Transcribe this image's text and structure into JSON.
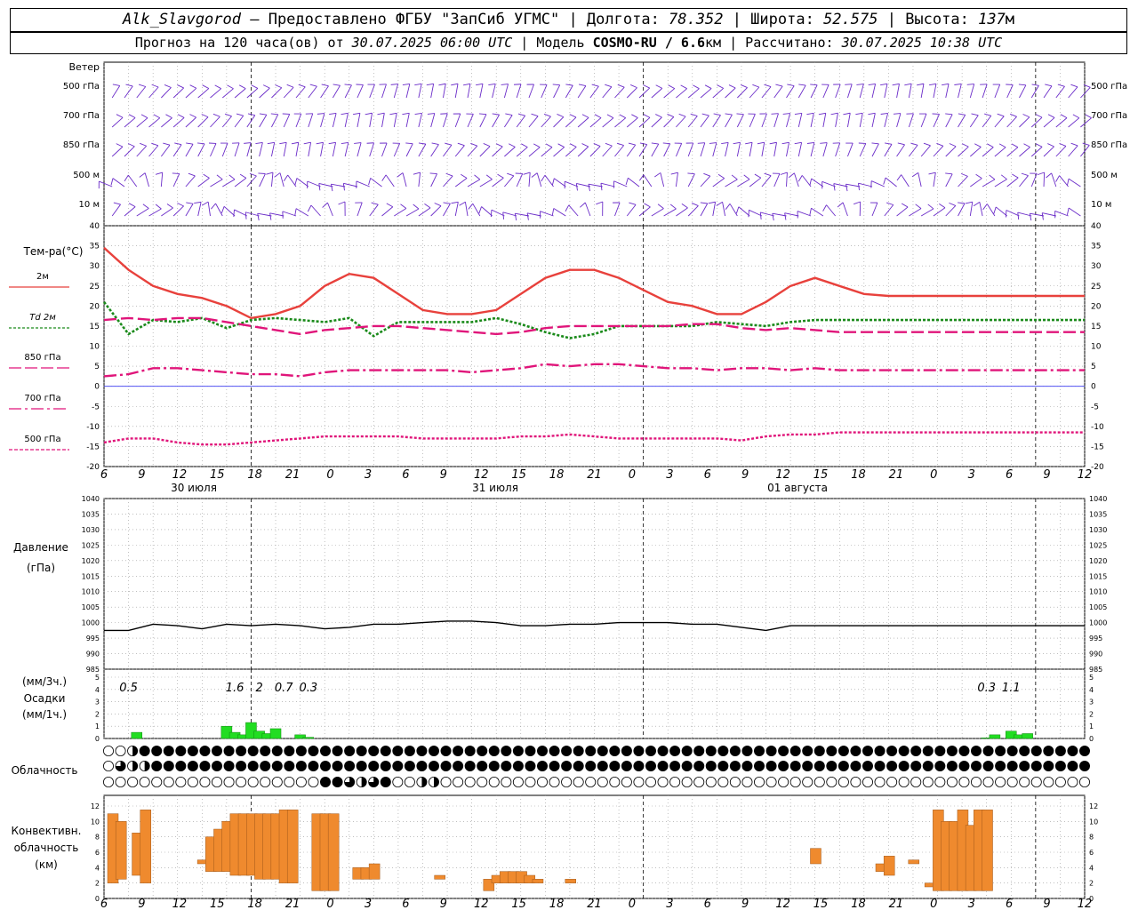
{
  "header": {
    "station": "Alk_Slavgorod",
    "provider": " — Предоставлено ФГБУ \"ЗапСиб УГМС\" | Долгота: ",
    "lon": "78.352",
    "lat_label": " | Широта: ",
    "lat": "52.575",
    "alt_label": " | Высота: ",
    "alt": "137",
    "alt_unit": "м",
    "forecast_label": "Прогноз на 120 часа(ов) от ",
    "forecast_from": "30.07.2025 06:00 UTC",
    "model_label": " | Модель ",
    "model": "COSMO-RU / 6.6",
    "model_unit": "км",
    "calc_label": " | Рассчитано: ",
    "calc_time": "30.07.2025 10:38 UTC"
  },
  "labels": {
    "wind_title": "Ветер",
    "wind_levels": [
      "500 гПа",
      "700 гПа",
      "850 гПа",
      "500 м",
      "10  м"
    ],
    "temp_title": "Тем-ра(°С)",
    "temp_legend": [
      {
        "label": "2м",
        "color": "#e8413c"
      },
      {
        "label": "Td  2м",
        "color": "#1a8a1a"
      },
      {
        "label": "850 гПа",
        "color": "#e0157a"
      },
      {
        "label": "700 гПа",
        "color": "#e0157a"
      },
      {
        "label": "500 гПа",
        "color": "#e0157a"
      }
    ],
    "pressure_title": "Давление",
    "pressure_unit": "(гПа)",
    "precip_unit_3h": "(мм/3ч.)",
    "precip_title": "Осадки",
    "precip_unit_1h": "(мм/1ч.)",
    "cloud_title": "Облачность",
    "conv_title_1": "Конвективн.",
    "conv_title_2": "облачность",
    "conv_unit": "(км)"
  },
  "axes": {
    "hour_ticks": [
      "6",
      "9",
      "12",
      "15",
      "18",
      "21",
      "0",
      "3",
      "6",
      "9",
      "12",
      "15",
      "18",
      "21",
      "0",
      "3",
      "6",
      "9",
      "12",
      "15",
      "18",
      "21",
      "0",
      "3",
      "6",
      "9",
      "12"
    ],
    "day_labels": [
      "30 июля",
      "31 июля",
      "01 августа"
    ],
    "temp_ticks": [
      40,
      35,
      30,
      25,
      20,
      15,
      10,
      5,
      0,
      -5,
      -10,
      -15,
      -20
    ],
    "pressure_ticks": [
      1040,
      1035,
      1030,
      1025,
      1020,
      1015,
      1010,
      1005,
      1000,
      995,
      990,
      985
    ],
    "precip_ticks": [
      5,
      4,
      3,
      2,
      1,
      0
    ],
    "conv_ticks": [
      12,
      10,
      8,
      6,
      4,
      2,
      0
    ]
  },
  "chart_data": {
    "type": "line",
    "x_hours": [
      0,
      3,
      6,
      9,
      12,
      15,
      18,
      21,
      24,
      27,
      30,
      33,
      36,
      39,
      42,
      45,
      48,
      51,
      54,
      57,
      60,
      63,
      66,
      69,
      72,
      75,
      78,
      81,
      84,
      87,
      90,
      93,
      96,
      99,
      102,
      105,
      108,
      111,
      114,
      117,
      120
    ],
    "series": [
      {
        "name": "2м",
        "color": "#e8413c",
        "values": [
          34.5,
          29,
          25,
          23,
          22,
          20,
          17,
          18,
          20,
          25,
          28,
          27,
          23,
          19,
          18,
          18,
          19,
          23,
          27,
          29,
          29,
          27,
          24,
          21,
          20,
          18,
          18,
          21,
          25,
          27,
          25,
          23,
          22.5,
          22.5,
          22.5,
          22.5,
          22.5,
          22.5,
          22.5,
          22.5,
          22.5
        ]
      },
      {
        "name": "Td  2м",
        "color": "#1a8a1a",
        "values": [
          21,
          13,
          16.5,
          16,
          17,
          14.5,
          16.5,
          17,
          16.5,
          16,
          17,
          12.5,
          16,
          16,
          16,
          16,
          17,
          15.5,
          13.5,
          12,
          13,
          15,
          15,
          15,
          15,
          16,
          15.5,
          15,
          16,
          16.5,
          16.5,
          16.5,
          16.5,
          16.5,
          16.5,
          16.5,
          16.5,
          16.5,
          16.5,
          16.5,
          16.5
        ]
      },
      {
        "name": "850 гПа",
        "color": "#e0157a",
        "values": [
          16.5,
          17,
          16.5,
          17,
          17,
          16,
          15,
          14,
          13,
          14,
          14.5,
          15,
          15,
          14.5,
          14,
          13.5,
          13,
          13.5,
          14.5,
          15,
          15,
          15,
          15,
          15,
          15.5,
          15.5,
          14.5,
          14,
          14.5,
          14,
          13.5,
          13.5,
          13.5,
          13.5,
          13.5,
          13.5,
          13.5,
          13.5,
          13.5,
          13.5,
          13.5
        ]
      },
      {
        "name": "700 гПа",
        "color": "#e0157a",
        "values": [
          2.5,
          3,
          4.5,
          4.5,
          4,
          3.5,
          3,
          3,
          2.5,
          3.5,
          4,
          4,
          4,
          4,
          4,
          3.5,
          4,
          4.5,
          5.5,
          5,
          5.5,
          5.5,
          5,
          4.5,
          4.5,
          4,
          4.5,
          4.5,
          4,
          4.5,
          4,
          4,
          4,
          4,
          4,
          4,
          4,
          4,
          4,
          4,
          4
        ]
      },
      {
        "name": "500 гПа",
        "color": "#e0157a",
        "values": [
          -14,
          -13,
          -13,
          -14,
          -14.5,
          -14.5,
          -14,
          -13.5,
          -13,
          -12.5,
          -12.5,
          -12.5,
          -12.5,
          -13,
          -13,
          -13,
          -13,
          -12.5,
          -12.5,
          -12,
          -12.5,
          -13,
          -13,
          -13,
          -13,
          -13,
          -13.5,
          -12.5,
          -12,
          -12,
          -11.5,
          -11.5,
          -11.5,
          -11.5,
          -11.5,
          -11.5,
          -11.5,
          -11.5,
          -11.5,
          -11.5,
          -11.5
        ]
      }
    ],
    "pressure": {
      "name": "Давление",
      "color": "#000000",
      "values": [
        997.5,
        997.5,
        999.5,
        999,
        998,
        999.5,
        999,
        999.5,
        999,
        998,
        998.5,
        999.5,
        999.5,
        1000,
        1000.5,
        1000.5,
        1000,
        999,
        999,
        999.5,
        999.5,
        1000,
        1000,
        1000,
        999.5,
        999.5,
        998.5,
        997.5,
        999,
        999,
        999,
        999,
        999,
        999,
        999,
        999,
        999,
        999,
        999,
        999,
        999
      ]
    },
    "precip_labels": [
      {
        "hour": 3,
        "text": "0.5"
      },
      {
        "hour": 16,
        "text": "1.6"
      },
      {
        "hour": 19,
        "text": "2"
      },
      {
        "hour": 22,
        "text": "0.7"
      },
      {
        "hour": 25,
        "text": "0.3"
      },
      {
        "hour": 108,
        "text": "0.3"
      },
      {
        "hour": 111,
        "text": "1.1"
      }
    ],
    "precip_bars_1h": [
      {
        "h": 4,
        "v": 0.5
      },
      {
        "h": 15,
        "v": 1.0
      },
      {
        "h": 16,
        "v": 0.5
      },
      {
        "h": 17,
        "v": 0.3
      },
      {
        "h": 18,
        "v": 1.3
      },
      {
        "h": 19,
        "v": 0.6
      },
      {
        "h": 20,
        "v": 0.4
      },
      {
        "h": 21,
        "v": 0.8
      },
      {
        "h": 24,
        "v": 0.3
      },
      {
        "h": 25,
        "v": 0.1
      },
      {
        "h": 108,
        "v": 0.05
      },
      {
        "h": 109,
        "v": 0.3
      },
      {
        "h": 111,
        "v": 0.6
      },
      {
        "h": 112,
        "v": 0.3
      },
      {
        "h": 113,
        "v": 0.4
      }
    ],
    "conv_bars_km": [
      {
        "h": 0,
        "lo": 2,
        "hi": 11
      },
      {
        "h": 1,
        "lo": 2.5,
        "hi": 10
      },
      {
        "h": 3,
        "lo": 3,
        "hi": 8.5
      },
      {
        "h": 4,
        "lo": 2,
        "hi": 11.5
      },
      {
        "h": 11,
        "lo": 4.5,
        "hi": 5
      },
      {
        "h": 12,
        "lo": 3.5,
        "hi": 8
      },
      {
        "h": 13,
        "lo": 3.5,
        "hi": 9
      },
      {
        "h": 14,
        "lo": 3.5,
        "hi": 10
      },
      {
        "h": 15,
        "lo": 3,
        "hi": 11
      },
      {
        "h": 16,
        "lo": 3,
        "hi": 11
      },
      {
        "h": 17,
        "lo": 3,
        "hi": 11
      },
      {
        "h": 18,
        "lo": 2.5,
        "hi": 11
      },
      {
        "h": 19,
        "lo": 2.5,
        "hi": 11
      },
      {
        "h": 20,
        "lo": 2.5,
        "hi": 11
      },
      {
        "h": 21,
        "lo": 2,
        "hi": 11.5
      },
      {
        "h": 22,
        "lo": 2,
        "hi": 11.5
      },
      {
        "h": 25,
        "lo": 1,
        "hi": 11
      },
      {
        "h": 26,
        "lo": 1,
        "hi": 11
      },
      {
        "h": 27,
        "lo": 1,
        "hi": 11
      },
      {
        "h": 30,
        "lo": 2.5,
        "hi": 4
      },
      {
        "h": 31,
        "lo": 2.5,
        "hi": 4
      },
      {
        "h": 32,
        "lo": 2.5,
        "hi": 4.5
      },
      {
        "h": 40,
        "lo": 2.5,
        "hi": 3
      },
      {
        "h": 46,
        "lo": 1,
        "hi": 2.5
      },
      {
        "h": 47,
        "lo": 2,
        "hi": 3
      },
      {
        "h": 48,
        "lo": 2,
        "hi": 3.5
      },
      {
        "h": 49,
        "lo": 2,
        "hi": 3.5
      },
      {
        "h": 50,
        "lo": 2,
        "hi": 3.5
      },
      {
        "h": 51,
        "lo": 2,
        "hi": 3
      },
      {
        "h": 52,
        "lo": 2,
        "hi": 2.5
      },
      {
        "h": 56,
        "lo": 2,
        "hi": 2.5
      },
      {
        "h": 86,
        "lo": 4.5,
        "hi": 6.5
      },
      {
        "h": 94,
        "lo": 3.5,
        "hi": 4.5
      },
      {
        "h": 95,
        "lo": 3,
        "hi": 5.5
      },
      {
        "h": 98,
        "lo": 4.5,
        "hi": 5
      },
      {
        "h": 100,
        "lo": 1.5,
        "hi": 2
      },
      {
        "h": 101,
        "lo": 1,
        "hi": 11.5
      },
      {
        "h": 102,
        "lo": 1,
        "hi": 10
      },
      {
        "h": 103,
        "lo": 1,
        "hi": 10
      },
      {
        "h": 104,
        "lo": 1,
        "hi": 11.5
      },
      {
        "h": 105,
        "lo": 1,
        "hi": 9.5
      },
      {
        "h": 106,
        "lo": 1,
        "hi": 11.5
      },
      {
        "h": 107,
        "lo": 1,
        "hi": 11.5
      }
    ],
    "cloud_cover_eighths": {
      "upper": [
        0,
        0,
        4,
        8,
        8,
        8,
        8,
        8,
        8,
        8,
        8,
        8,
        8,
        8,
        8,
        8,
        8,
        8,
        8,
        8,
        8,
        8,
        8,
        8,
        8,
        8,
        8,
        8,
        8,
        8,
        8,
        8,
        8,
        8,
        8,
        8,
        8,
        8,
        8,
        8,
        8,
        8,
        8,
        8,
        8,
        8,
        8,
        8,
        8,
        8,
        8,
        8,
        8,
        8,
        8,
        8,
        8,
        8,
        8,
        8,
        8,
        8,
        8,
        8,
        8,
        8,
        8,
        8,
        8,
        8,
        8,
        8,
        8,
        8,
        8,
        8,
        8,
        8,
        8,
        8,
        8,
        8
      ],
      "middle": [
        0,
        6,
        4,
        4,
        8,
        8,
        8,
        8,
        8,
        8,
        8,
        8,
        8,
        8,
        8,
        8,
        8,
        8,
        8,
        8,
        8,
        8,
        8,
        8,
        8,
        8,
        8,
        8,
        8,
        8,
        8,
        8,
        8,
        8,
        8,
        8,
        8,
        8,
        8,
        8,
        8,
        8,
        8,
        8,
        8,
        8,
        8,
        8,
        8,
        8,
        8,
        8,
        8,
        8,
        8,
        8,
        8,
        8,
        8,
        8,
        8,
        8,
        8,
        8,
        8,
        8,
        8,
        8,
        8,
        8,
        8,
        8,
        8,
        8,
        8,
        8,
        8,
        8,
        8,
        8,
        8,
        8
      ],
      "lower": [
        0,
        0,
        0,
        0,
        0,
        0,
        0,
        0,
        0,
        0,
        0,
        0,
        0,
        0,
        0,
        0,
        0,
        0,
        8,
        8,
        6,
        4,
        6,
        8,
        0,
        0,
        4,
        4,
        0,
        0,
        0,
        0,
        0,
        0,
        0,
        0,
        0,
        0,
        0,
        0,
        0,
        0,
        0,
        0,
        0,
        0,
        0,
        0,
        0,
        0,
        0,
        0,
        0,
        0,
        0,
        0,
        0,
        0,
        0,
        0,
        0,
        0,
        0,
        0,
        0,
        0,
        0,
        0,
        0,
        0,
        0,
        0,
        0,
        0,
        0,
        0,
        0,
        0,
        0,
        0,
        0,
        0
      ]
    }
  }
}
